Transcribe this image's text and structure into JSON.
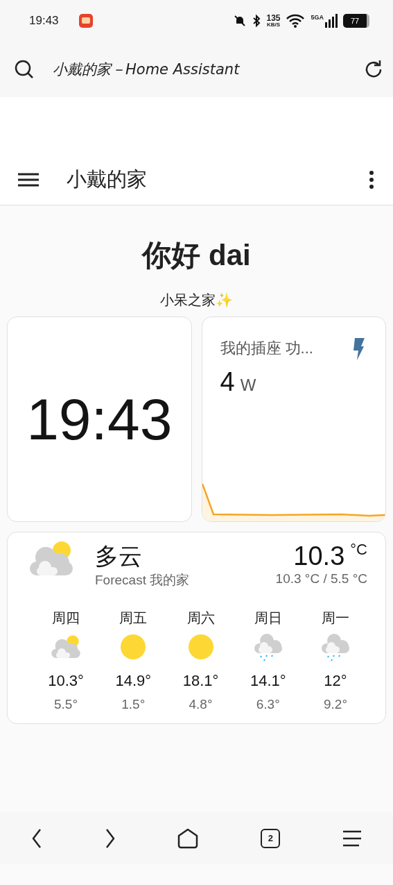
{
  "status_bar": {
    "time": "19:43",
    "net_speed": "135",
    "net_unit": "KB/S",
    "network": "5GA",
    "battery": "77"
  },
  "browser": {
    "page_title": "小戴的家－Home Assistant",
    "tab_count": "2"
  },
  "header": {
    "title": "小戴的家"
  },
  "greeting": {
    "title": "你好 dai",
    "subtitle": "小呆之家✨"
  },
  "clock_card": {
    "time": "19:43"
  },
  "sensor_card": {
    "name": "我的插座 功...",
    "value": "4",
    "unit": "W"
  },
  "weather": {
    "kind": "partly-cloudy",
    "condition": "多云",
    "location": "Forecast 我的家",
    "temperature": "10.3",
    "unit": "°C",
    "range": "10.3 °C / 5.5 °C",
    "forecast": [
      {
        "day": "周四",
        "kind": "partly-cloudy",
        "high": "10.3°",
        "low": "5.5°"
      },
      {
        "day": "周五",
        "kind": "sunny",
        "high": "14.9°",
        "low": "1.5°"
      },
      {
        "day": "周六",
        "kind": "sunny",
        "high": "18.1°",
        "low": "4.8°"
      },
      {
        "day": "周日",
        "kind": "rainy",
        "high": "14.1°",
        "low": "6.3°"
      },
      {
        "day": "周一",
        "kind": "rainy",
        "high": "12°",
        "low": "9.2°"
      }
    ]
  }
}
